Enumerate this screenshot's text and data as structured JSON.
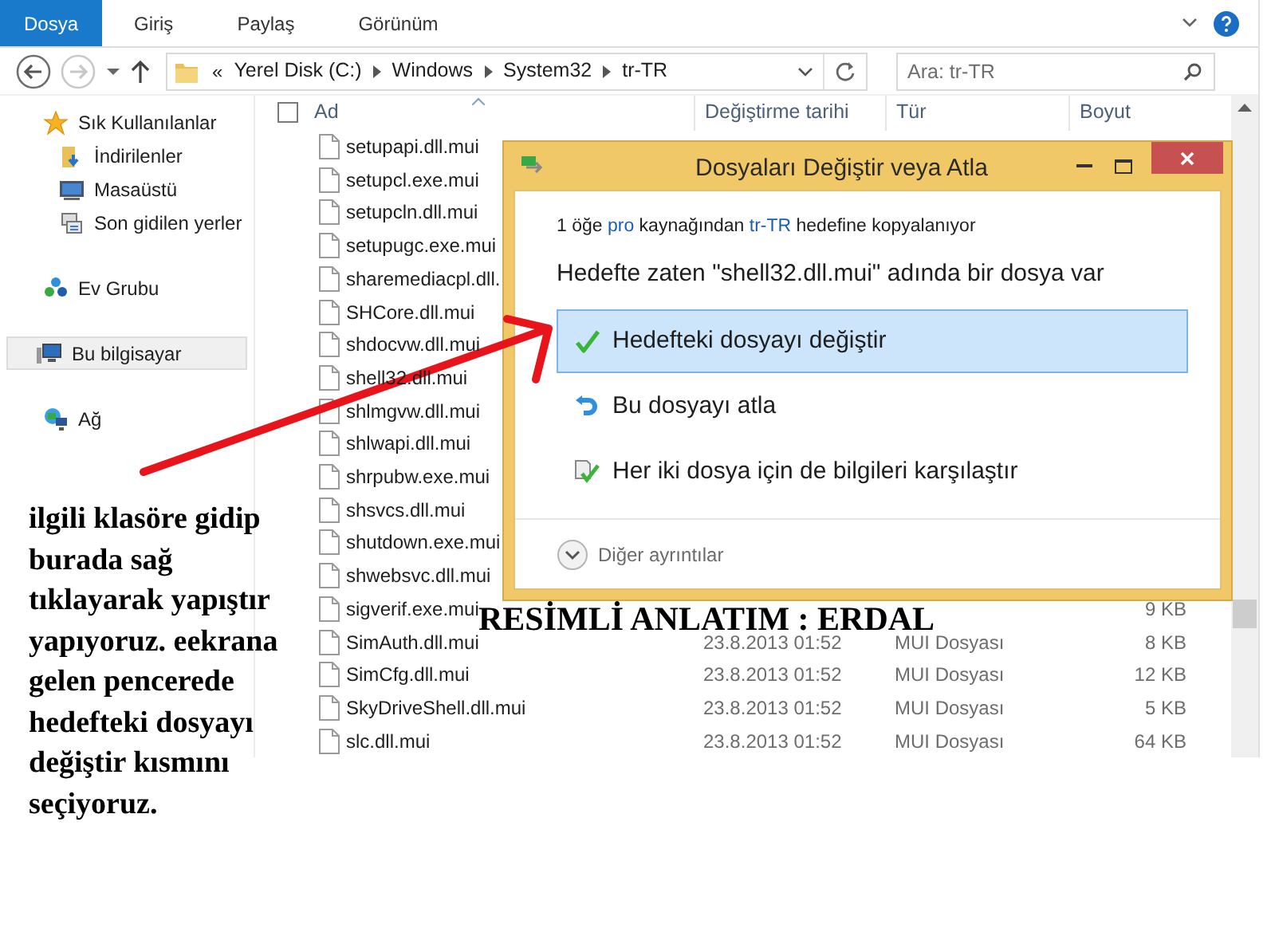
{
  "ribbon": {
    "tabs": [
      {
        "label": "Dosya",
        "kind": "file"
      },
      {
        "label": "Giriş",
        "kind": "tab"
      },
      {
        "label": "Paylaş",
        "kind": "tab"
      },
      {
        "label": "Görünüm",
        "kind": "tab"
      }
    ]
  },
  "address": {
    "prefix": "«",
    "crumbs": [
      "Yerel Disk (C:)",
      "Windows",
      "System32",
      "tr-TR"
    ]
  },
  "search": {
    "placeholder": "Ara: tr-TR"
  },
  "nav": [
    {
      "label": "Sık Kullanılanlar",
      "kind": "star",
      "selected": false,
      "children": [
        {
          "label": "İndirilenler",
          "kind": "downloads",
          "selected": false
        },
        {
          "label": "Masaüstü",
          "kind": "desktop",
          "selected": false
        },
        {
          "label": "Son gidilen yerler",
          "kind": "recent",
          "selected": false
        }
      ]
    },
    {
      "label": "Ev Grubu",
      "kind": "homegroup",
      "selected": false
    },
    {
      "label": "Bu bilgisayar",
      "kind": "computer",
      "selected": true
    },
    {
      "label": "Ağ",
      "kind": "network",
      "selected": false
    }
  ],
  "table": {
    "select_all": {
      "checked": false
    },
    "columns": [
      "Ad",
      "Değiştirme tarihi",
      "Tür",
      "Boyut"
    ],
    "rows": [
      {
        "name": "setupapi.dll.mui"
      },
      {
        "name": "setupcl.exe.mui"
      },
      {
        "name": "setupcln.dll.mui"
      },
      {
        "name": "setupugc.exe.mui"
      },
      {
        "name": "sharemediacpl.dll."
      },
      {
        "name": "SHCore.dll.mui"
      },
      {
        "name": "shdocvw.dll.mui"
      },
      {
        "name": "shell32.dll.mui"
      },
      {
        "name": "shlmgvw.dll.mui"
      },
      {
        "name": "shlwapi.dll.mui"
      },
      {
        "name": "shrpubw.exe.mui"
      },
      {
        "name": "shsvcs.dll.mui"
      },
      {
        "name": "shutdown.exe.mui"
      },
      {
        "name": "shwebsvc.dll.mui"
      },
      {
        "name": "sigverif.exe.mui",
        "size": "9 KB"
      },
      {
        "name": "SimAuth.dll.mui",
        "date": "23.8.2013 01:52",
        "type": "MUI Dosyası",
        "size": "8 KB"
      },
      {
        "name": "SimCfg.dll.mui",
        "date": "23.8.2013 01:52",
        "type": "MUI Dosyası",
        "size": "12 KB"
      },
      {
        "name": "SkyDriveShell.dll.mui",
        "date": "23.8.2013 01:52",
        "type": "MUI Dosyası",
        "size": "5 KB"
      },
      {
        "name": "slc.dll.mui",
        "date": "23.8.2013 01:52",
        "type": "MUI Dosyası",
        "size": "64 KB"
      }
    ]
  },
  "dialog": {
    "title": "Dosyaları Değiştir veya Atla",
    "copy_info": [
      {
        "text": "1 öğe ",
        "kind": "text"
      },
      {
        "text": "pro",
        "kind": "link"
      },
      {
        "text": " kaynağından ",
        "kind": "text"
      },
      {
        "text": "tr-TR",
        "kind": "link"
      },
      {
        "text": " hedefine kopyalanıyor",
        "kind": "text"
      }
    ],
    "heading": "Hedefte zaten \"shell32.dll.mui\" adında bir dosya var",
    "options": [
      {
        "label": "Hedefteki dosyayı değiştir",
        "kind": "check",
        "selected": true
      },
      {
        "label": "Bu dosyayı atla",
        "kind": "skip",
        "selected": false
      },
      {
        "label": "Her iki dosya için de bilgileri karşılaştır",
        "kind": "compare",
        "selected": false
      }
    ],
    "more_details": "Diğer ayrıntılar"
  },
  "annotations": {
    "instructions": "ilgili klasöre gidip\nburada sağ\ntıklayarak yapıştır\nyapıyoruz. eekrana\ngelen pencerede\nhedefteki dosyayı\ndeğiştir kısmını\nseçiyoruz.",
    "banner": "RESİMLİ ANLATIM : ERDAL"
  }
}
